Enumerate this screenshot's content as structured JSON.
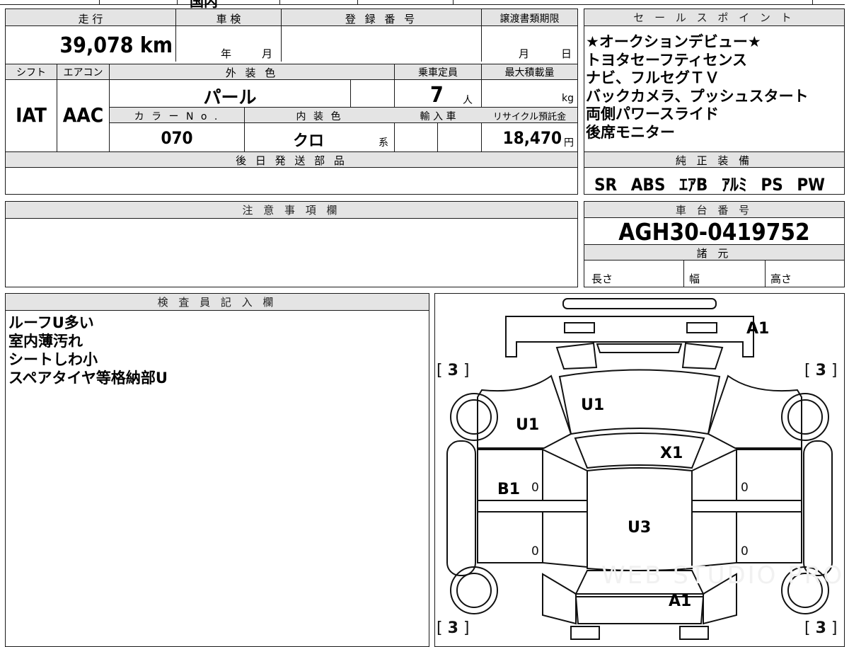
{
  "top_strip": {
    "partial_text": "国内"
  },
  "left_table": {
    "mileage_label": "走 行",
    "mileage_value": "39,078 km",
    "inspection_label": "車 検",
    "inspection_year": "年",
    "inspection_month": "月",
    "registration_label": "登 録 番 号",
    "transfer_deadline_label": "譲渡書類期限",
    "transfer_month": "月",
    "transfer_day": "日",
    "shift_label": "シフト",
    "shift_value": "IAT",
    "ac_label": "エアコン",
    "ac_value": "AAC",
    "exterior_color_label": "外 装 色",
    "exterior_color_value": "パール",
    "capacity_label": "乗車定員",
    "capacity_value": "7",
    "capacity_unit": "人",
    "max_load_label": "最大積載量",
    "max_load_unit": "kg",
    "color_no_label": "カ ラ ー N o .",
    "color_no_value": "070",
    "interior_color_label": "内 装 色",
    "interior_color_value": "クロ",
    "interior_color_suffix": "系",
    "import_label": "輸 入 車",
    "recycle_label": "リサイクル預託金",
    "recycle_value": "18,470",
    "recycle_unit": "円",
    "later_parts_label": "後 日 発 送 部 品"
  },
  "sales_points": {
    "label": "セ ー ル ス ポ イ ン ト",
    "lines": [
      "★オークションデビュー★",
      "トヨタセーフティセンス",
      "ナビ、フルセグＴＶ",
      "バックカメラ、プッシュスタート",
      "両側パワースライド",
      "後席モニター"
    ]
  },
  "equipment": {
    "label": "純 正 装 備",
    "items": [
      "SR",
      "ABS",
      "ｴｱB",
      "ｱﾙﾐ",
      "PS",
      "PW"
    ]
  },
  "caution": {
    "label": "注 意 事 項 欄"
  },
  "chassis": {
    "label": "車 台 番 号",
    "value": "AGH30-0419752"
  },
  "specs": {
    "label": "諸 元",
    "length_label": "長さ",
    "width_label": "幅",
    "height_label": "高さ"
  },
  "inspector": {
    "label": "検 査 員 記 入 欄",
    "notes": [
      "ルーフU多い",
      "室内薄汚れ",
      "シートしわ小",
      "スペアタイヤ等格納部U"
    ]
  },
  "diagram": {
    "marks": {
      "roof_front": "A1",
      "hood": "U1",
      "left_front_fender": "U1",
      "windshield": "X1",
      "left_front_door": "B1",
      "roof": "U3",
      "rear": "A1"
    },
    "tires": {
      "front_left": "3",
      "front_right": "3",
      "rear_left": "3",
      "rear_right": "3"
    },
    "door_zeros": {
      "lf": "0",
      "rf": "0",
      "lr": "0",
      "rr": "0"
    },
    "watermark": "WEB STUDIO PRO"
  }
}
